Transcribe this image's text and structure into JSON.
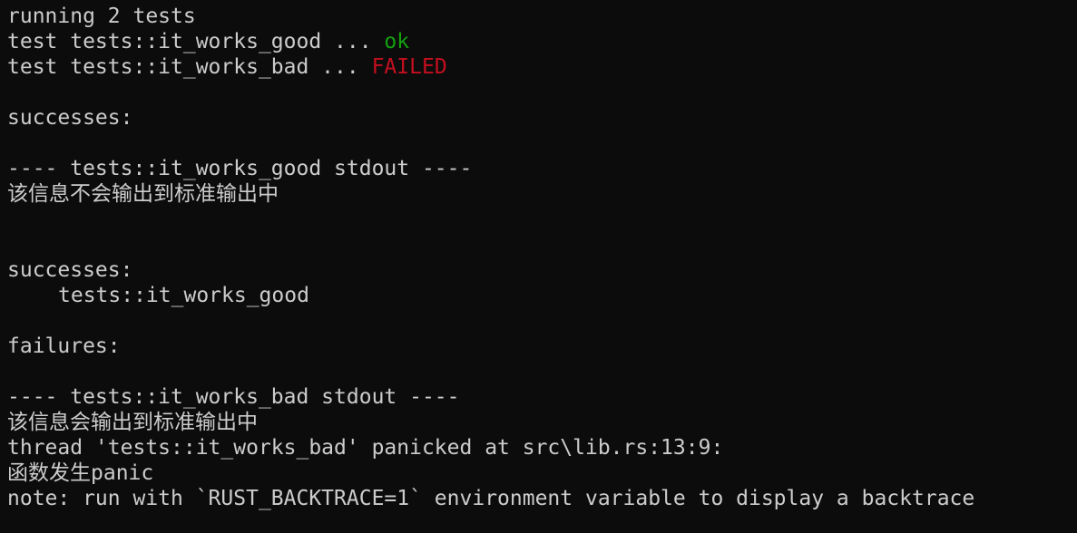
{
  "terminal": {
    "running": "running 2 tests",
    "test_good_prefix": "test tests::it_works_good ... ",
    "test_good_status": "ok",
    "test_bad_prefix": "test tests::it_works_bad ... ",
    "test_bad_status": "FAILED",
    "successes_header_1": "successes:",
    "good_stdout_header": "---- tests::it_works_good stdout ----",
    "good_stdout_text": "该信息不会输出到标准输出中",
    "successes_header_2": "successes:",
    "successes_item": "tests::it_works_good",
    "failures_header": "failures:",
    "bad_stdout_header": "---- tests::it_works_bad stdout ----",
    "bad_stdout_text": "该信息会输出到标准输出中",
    "panic_line": "thread 'tests::it_works_bad' panicked at src\\lib.rs:13:9:",
    "panic_message": "函数发生panic",
    "note_line": "note: run with `RUST_BACKTRACE=1` environment variable to display a backtrace"
  },
  "colors": {
    "background": "#0c0c0c",
    "text": "#cccccc",
    "ok": "#13a10e",
    "failed": "#c50f1f"
  }
}
